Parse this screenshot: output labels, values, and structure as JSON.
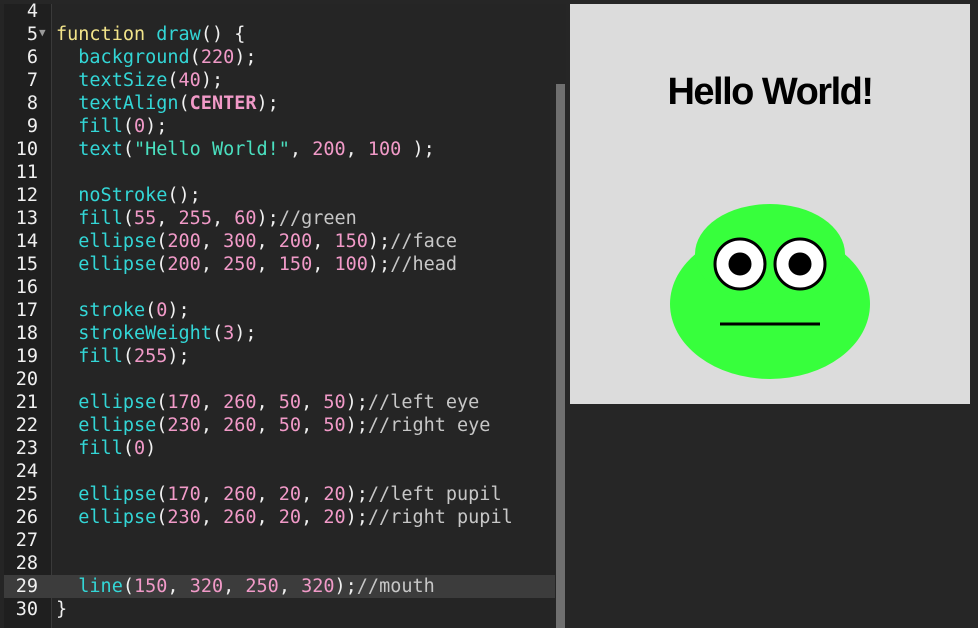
{
  "editor": {
    "active_line": 29,
    "lines": [
      {
        "n": "4",
        "fold": "",
        "tokens": []
      },
      {
        "n": "5",
        "fold": "▼",
        "tokens": [
          [
            "kw",
            "function"
          ],
          [
            "p",
            " "
          ],
          [
            "fn",
            "draw"
          ],
          [
            "p",
            "() {"
          ]
        ]
      },
      {
        "n": "6",
        "fold": "",
        "tokens": [
          [
            "p",
            "  "
          ],
          [
            "fn",
            "background"
          ],
          [
            "p",
            "("
          ],
          [
            "num",
            "220"
          ],
          [
            "p",
            ");"
          ]
        ]
      },
      {
        "n": "7",
        "fold": "",
        "tokens": [
          [
            "p",
            "  "
          ],
          [
            "fn",
            "textSize"
          ],
          [
            "p",
            "("
          ],
          [
            "num",
            "40"
          ],
          [
            "p",
            ");"
          ]
        ]
      },
      {
        "n": "8",
        "fold": "",
        "tokens": [
          [
            "p",
            "  "
          ],
          [
            "fn",
            "textAlign"
          ],
          [
            "p",
            "("
          ],
          [
            "const",
            "CENTER"
          ],
          [
            "p",
            ");"
          ]
        ]
      },
      {
        "n": "9",
        "fold": "",
        "tokens": [
          [
            "p",
            "  "
          ],
          [
            "fn",
            "fill"
          ],
          [
            "p",
            "("
          ],
          [
            "num",
            "0"
          ],
          [
            "p",
            ");"
          ]
        ]
      },
      {
        "n": "10",
        "fold": "",
        "tokens": [
          [
            "p",
            "  "
          ],
          [
            "fn",
            "text"
          ],
          [
            "p",
            "("
          ],
          [
            "str",
            "\"Hello World!\""
          ],
          [
            "p",
            ", "
          ],
          [
            "num",
            "200"
          ],
          [
            "p",
            ", "
          ],
          [
            "num",
            "100"
          ],
          [
            "p",
            " );"
          ]
        ]
      },
      {
        "n": "11",
        "fold": "",
        "tokens": []
      },
      {
        "n": "12",
        "fold": "",
        "tokens": [
          [
            "p",
            "  "
          ],
          [
            "fn",
            "noStroke"
          ],
          [
            "p",
            "();"
          ]
        ]
      },
      {
        "n": "13",
        "fold": "",
        "tokens": [
          [
            "p",
            "  "
          ],
          [
            "fn",
            "fill"
          ],
          [
            "p",
            "("
          ],
          [
            "num",
            "55"
          ],
          [
            "p",
            ", "
          ],
          [
            "num",
            "255"
          ],
          [
            "p",
            ", "
          ],
          [
            "num",
            "60"
          ],
          [
            "p",
            ");"
          ],
          [
            "cm",
            "//green"
          ]
        ]
      },
      {
        "n": "14",
        "fold": "",
        "tokens": [
          [
            "p",
            "  "
          ],
          [
            "fn",
            "ellipse"
          ],
          [
            "p",
            "("
          ],
          [
            "num",
            "200"
          ],
          [
            "p",
            ", "
          ],
          [
            "num",
            "300"
          ],
          [
            "p",
            ", "
          ],
          [
            "num",
            "200"
          ],
          [
            "p",
            ", "
          ],
          [
            "num",
            "150"
          ],
          [
            "p",
            ");"
          ],
          [
            "cm",
            "//face"
          ]
        ]
      },
      {
        "n": "15",
        "fold": "",
        "tokens": [
          [
            "p",
            "  "
          ],
          [
            "fn",
            "ellipse"
          ],
          [
            "p",
            "("
          ],
          [
            "num",
            "200"
          ],
          [
            "p",
            ", "
          ],
          [
            "num",
            "250"
          ],
          [
            "p",
            ", "
          ],
          [
            "num",
            "150"
          ],
          [
            "p",
            ", "
          ],
          [
            "num",
            "100"
          ],
          [
            "p",
            ");"
          ],
          [
            "cm",
            "//head"
          ]
        ]
      },
      {
        "n": "16",
        "fold": "",
        "tokens": []
      },
      {
        "n": "17",
        "fold": "",
        "tokens": [
          [
            "p",
            "  "
          ],
          [
            "fn",
            "stroke"
          ],
          [
            "p",
            "("
          ],
          [
            "num",
            "0"
          ],
          [
            "p",
            ");"
          ]
        ]
      },
      {
        "n": "18",
        "fold": "",
        "tokens": [
          [
            "p",
            "  "
          ],
          [
            "fn",
            "strokeWeight"
          ],
          [
            "p",
            "("
          ],
          [
            "num",
            "3"
          ],
          [
            "p",
            ");"
          ]
        ]
      },
      {
        "n": "19",
        "fold": "",
        "tokens": [
          [
            "p",
            "  "
          ],
          [
            "fn",
            "fill"
          ],
          [
            "p",
            "("
          ],
          [
            "num",
            "255"
          ],
          [
            "p",
            ");"
          ]
        ]
      },
      {
        "n": "20",
        "fold": "",
        "tokens": []
      },
      {
        "n": "21",
        "fold": "",
        "tokens": [
          [
            "p",
            "  "
          ],
          [
            "fn",
            "ellipse"
          ],
          [
            "p",
            "("
          ],
          [
            "num",
            "170"
          ],
          [
            "p",
            ", "
          ],
          [
            "num",
            "260"
          ],
          [
            "p",
            ", "
          ],
          [
            "num",
            "50"
          ],
          [
            "p",
            ", "
          ],
          [
            "num",
            "50"
          ],
          [
            "p",
            ");"
          ],
          [
            "cm",
            "//left eye"
          ]
        ]
      },
      {
        "n": "22",
        "fold": "",
        "tokens": [
          [
            "p",
            "  "
          ],
          [
            "fn",
            "ellipse"
          ],
          [
            "p",
            "("
          ],
          [
            "num",
            "230"
          ],
          [
            "p",
            ", "
          ],
          [
            "num",
            "260"
          ],
          [
            "p",
            ", "
          ],
          [
            "num",
            "50"
          ],
          [
            "p",
            ", "
          ],
          [
            "num",
            "50"
          ],
          [
            "p",
            ");"
          ],
          [
            "cm",
            "//right eye"
          ]
        ]
      },
      {
        "n": "23",
        "fold": "",
        "tokens": [
          [
            "p",
            "  "
          ],
          [
            "fn",
            "fill"
          ],
          [
            "p",
            "("
          ],
          [
            "num",
            "0"
          ],
          [
            "p",
            ")"
          ]
        ]
      },
      {
        "n": "24",
        "fold": "",
        "tokens": []
      },
      {
        "n": "25",
        "fold": "",
        "tokens": [
          [
            "p",
            "  "
          ],
          [
            "fn",
            "ellipse"
          ],
          [
            "p",
            "("
          ],
          [
            "num",
            "170"
          ],
          [
            "p",
            ", "
          ],
          [
            "num",
            "260"
          ],
          [
            "p",
            ", "
          ],
          [
            "num",
            "20"
          ],
          [
            "p",
            ", "
          ],
          [
            "num",
            "20"
          ],
          [
            "p",
            ");"
          ],
          [
            "cm",
            "//left pupil"
          ]
        ]
      },
      {
        "n": "26",
        "fold": "",
        "tokens": [
          [
            "p",
            "  "
          ],
          [
            "fn",
            "ellipse"
          ],
          [
            "p",
            "("
          ],
          [
            "num",
            "230"
          ],
          [
            "p",
            ", "
          ],
          [
            "num",
            "260"
          ],
          [
            "p",
            ", "
          ],
          [
            "num",
            "20"
          ],
          [
            "p",
            ", "
          ],
          [
            "num",
            "20"
          ],
          [
            "p",
            ");"
          ],
          [
            "cm",
            "//right pupil"
          ]
        ]
      },
      {
        "n": "27",
        "fold": "",
        "tokens": []
      },
      {
        "n": "28",
        "fold": "",
        "tokens": []
      },
      {
        "n": "29",
        "fold": "",
        "tokens": [
          [
            "p",
            "  "
          ],
          [
            "fn",
            "line"
          ],
          [
            "p",
            "("
          ],
          [
            "num",
            "150"
          ],
          [
            "p",
            ", "
          ],
          [
            "num",
            "320"
          ],
          [
            "p",
            ", "
          ],
          [
            "num",
            "250"
          ],
          [
            "p",
            ", "
          ],
          [
            "num",
            "320"
          ],
          [
            "p",
            ");"
          ],
          [
            "cm",
            "//mouth"
          ]
        ]
      },
      {
        "n": "30",
        "fold": "",
        "tokens": [
          [
            "p",
            "}"
          ]
        ]
      }
    ]
  },
  "preview": {
    "text": "Hello World!",
    "background": "#dcdcdc",
    "face_color": "#37ff3c",
    "eye_color": "#ffffff",
    "pupil_color": "#000000",
    "stroke_color": "#000000"
  }
}
